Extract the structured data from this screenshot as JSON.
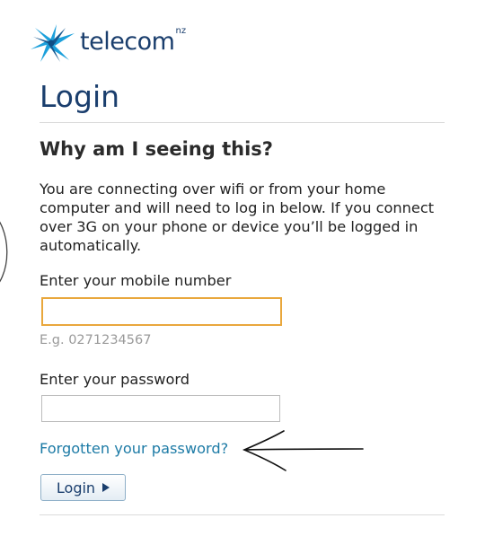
{
  "brand": {
    "name": "telecom",
    "suffix": "nz",
    "logo_icon": "telecom-star-logo",
    "color": "#1a3e6d"
  },
  "page_title": "Login",
  "why": {
    "heading": "Why am I seeing this?",
    "text": "You are connecting over wifi or from your home computer and will need to log in below. If you connect over 3G on your phone or device you’ll be logged in automatically."
  },
  "form": {
    "mobile_label": "Enter your mobile number",
    "mobile_value": "",
    "mobile_hint": "E.g. 0271234567",
    "password_label": "Enter your password",
    "password_value": "",
    "forgot_link": "Forgotten your password?",
    "submit_label": "Login",
    "submit_icon": "play-triangle-icon"
  },
  "colors": {
    "accent": "#1a3e6d",
    "link": "#1d7ba6",
    "focus": "#e9a73c",
    "hint": "#9a9a9a"
  }
}
